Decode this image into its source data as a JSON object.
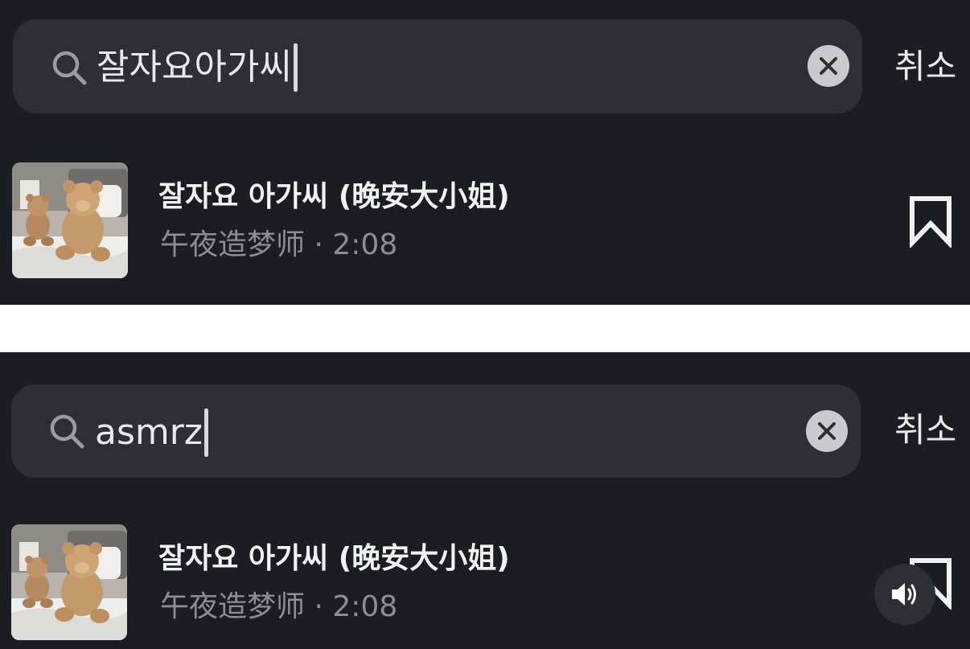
{
  "screen_top": {
    "search": {
      "query": "잘자요아가씨",
      "cancel_label": "취소"
    },
    "result": {
      "title": "잘자요 아가씨 (晚安大小姐)",
      "artist": "午夜造梦师",
      "separator": "·",
      "duration": "2:08"
    }
  },
  "screen_bottom": {
    "search": {
      "query": "asmrz",
      "cancel_label": "취소"
    },
    "result": {
      "title": "잘자요 아가씨 (晚安大小姐)",
      "artist": "午夜造梦师",
      "separator": "·",
      "duration": "2:08"
    }
  },
  "icons": {
    "search": "search-icon",
    "clear": "close-icon",
    "bookmark": "bookmark-icon",
    "volume": "volume-icon"
  },
  "colors": {
    "background": "#1c1d22",
    "search_field": "#2c2f36",
    "primary_text": "#f2f2f4",
    "secondary_text": "#8c8e95"
  }
}
